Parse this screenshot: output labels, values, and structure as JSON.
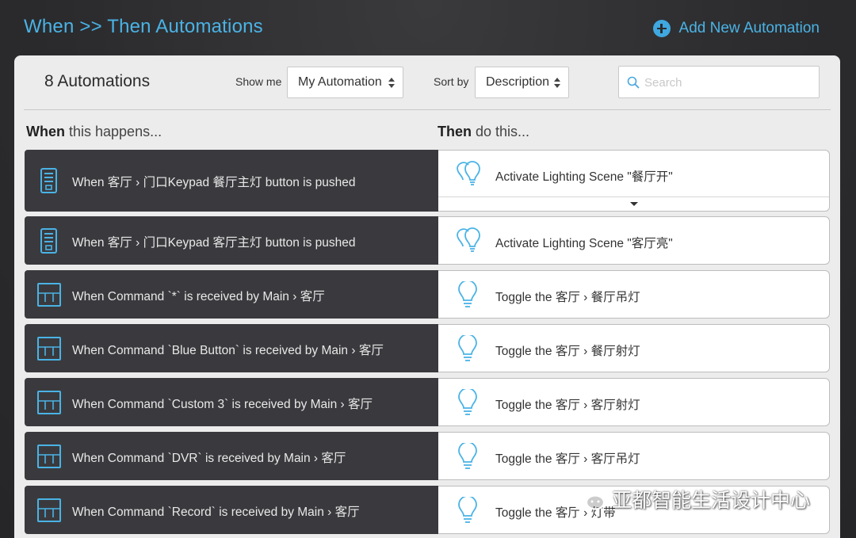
{
  "header": {
    "title": "When >> Then Automations",
    "add_button_label": "Add New Automation",
    "add_icon": "plus-circle-icon",
    "accent_color": "#4ab3e6"
  },
  "toolbar": {
    "count_label": "8 Automations",
    "show_me_label": "Show me",
    "show_me_value": "My Automation",
    "sort_by_label": "Sort by",
    "sort_by_value": "Description",
    "search_placeholder": "Search",
    "search_value": ""
  },
  "columns": {
    "when_bold": "When",
    "when_rest": " this happens...",
    "then_bold": "Then",
    "then_rest": " do this..."
  },
  "automations": [
    {
      "when": "When 客厅 › 门口Keypad 餐厅主灯 button is pushed",
      "when_icon": "keypad-icon",
      "then": "Activate Lighting Scene \"餐厅开\"",
      "then_icon": "lighting-scene-icon",
      "expanded": true
    },
    {
      "when": "When 客厅 › 门口Keypad 客厅主灯 button is pushed",
      "when_icon": "keypad-icon",
      "then": "Activate Lighting Scene \"客厅亮\"",
      "then_icon": "lighting-scene-icon"
    },
    {
      "when": "When Command `*` is received by Main › 客厅",
      "when_icon": "remote-command-icon",
      "then": "Toggle the 客厅 › 餐厅吊灯",
      "then_icon": "light-bulb-icon"
    },
    {
      "when": "When Command `Blue Button` is received by Main › 客厅",
      "when_icon": "remote-command-icon",
      "then": "Toggle the 客厅 › 餐厅射灯",
      "then_icon": "light-bulb-icon"
    },
    {
      "when": "When Command `Custom 3` is received by Main › 客厅",
      "when_icon": "remote-command-icon",
      "then": "Toggle the 客厅 › 客厅射灯",
      "then_icon": "light-bulb-icon"
    },
    {
      "when": "When Command `DVR` is received by Main › 客厅",
      "when_icon": "remote-command-icon",
      "then": "Toggle the 客厅 › 客厅吊灯",
      "then_icon": "light-bulb-icon"
    },
    {
      "when": "When Command `Record` is received by Main › 客厅",
      "when_icon": "remote-command-icon",
      "then": "Toggle the 客厅 › 灯带",
      "then_icon": "light-bulb-icon"
    }
  ],
  "watermark": {
    "text": "亚都智能生活设计中心",
    "icon": "wechat-icon"
  }
}
